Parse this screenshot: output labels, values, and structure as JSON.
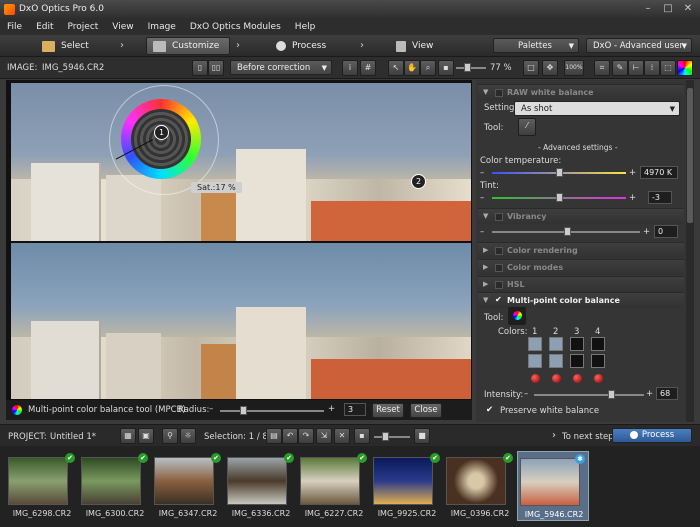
{
  "window": {
    "title": "DxO Optics Pro 6.0",
    "controls": [
      "–",
      "□",
      "✕"
    ]
  },
  "menu": [
    "File",
    "Edit",
    "Project",
    "View",
    "Image",
    "DxO Optics Modules",
    "Help"
  ],
  "tabs": [
    {
      "label": "Select"
    },
    {
      "label": "Customize",
      "active": true
    },
    {
      "label": "Process"
    },
    {
      "label": "View"
    }
  ],
  "tabbar": {
    "palettes": "Palettes",
    "workspace": "DxO - Advanced user"
  },
  "toolbar": {
    "image_label": "IMAGE:",
    "image_name": "IMG_5946.CR2",
    "compare": "Before correction",
    "zoom": "77 %",
    "zoom100": "100%"
  },
  "viewer": {
    "marker1": "1",
    "marker2": "2",
    "sat_readout": "Sat.:17 %"
  },
  "mpcb": {
    "label": "Multi-point color balance tool (MPCB)",
    "radius_label": "Radius:",
    "radius_value": "3",
    "reset": "Reset",
    "close": "Close"
  },
  "panel": {
    "raw_wb": {
      "title": "RAW white balance",
      "setting_label": "Setting:",
      "setting_value": "As shot",
      "tool_label": "Tool:",
      "advanced": "- Advanced settings -",
      "temp_label": "Color temperature:",
      "temp_value": "4970 K",
      "tint_label": "Tint:",
      "tint_value": "-3"
    },
    "vibrancy": {
      "title": "Vibrancy",
      "value": "0"
    },
    "color_rendering": "Color rendering",
    "color_modes": "Color modes",
    "hsl": "HSL",
    "mpcb": {
      "title": "Multi-point color balance",
      "tool_label": "Tool:",
      "colors_label": "Colors:",
      "cols": [
        "1",
        "2",
        "3",
        "4"
      ],
      "intensity_label": "Intensity:",
      "intensity_value": "68",
      "preserve": "Preserve white balance"
    }
  },
  "project": {
    "label": "PROJECT:",
    "name": "Untitled 1*",
    "selection": "Selection: 1 / 8",
    "next_step": "To next step",
    "process": "Process"
  },
  "filmstrip": [
    "IMG_6298.CR2",
    "IMG_6300.CR2",
    "IMG_6347.CR2",
    "IMG_6336.CR2",
    "IMG_6227.CR2",
    "IMG_9925.CR2",
    "IMG_0396.CR2",
    "IMG_5946.CR2"
  ],
  "colors": {
    "accent": "#4a7fc0",
    "check": "#2a9a2a",
    "active_tab": "#5a5a5a"
  }
}
